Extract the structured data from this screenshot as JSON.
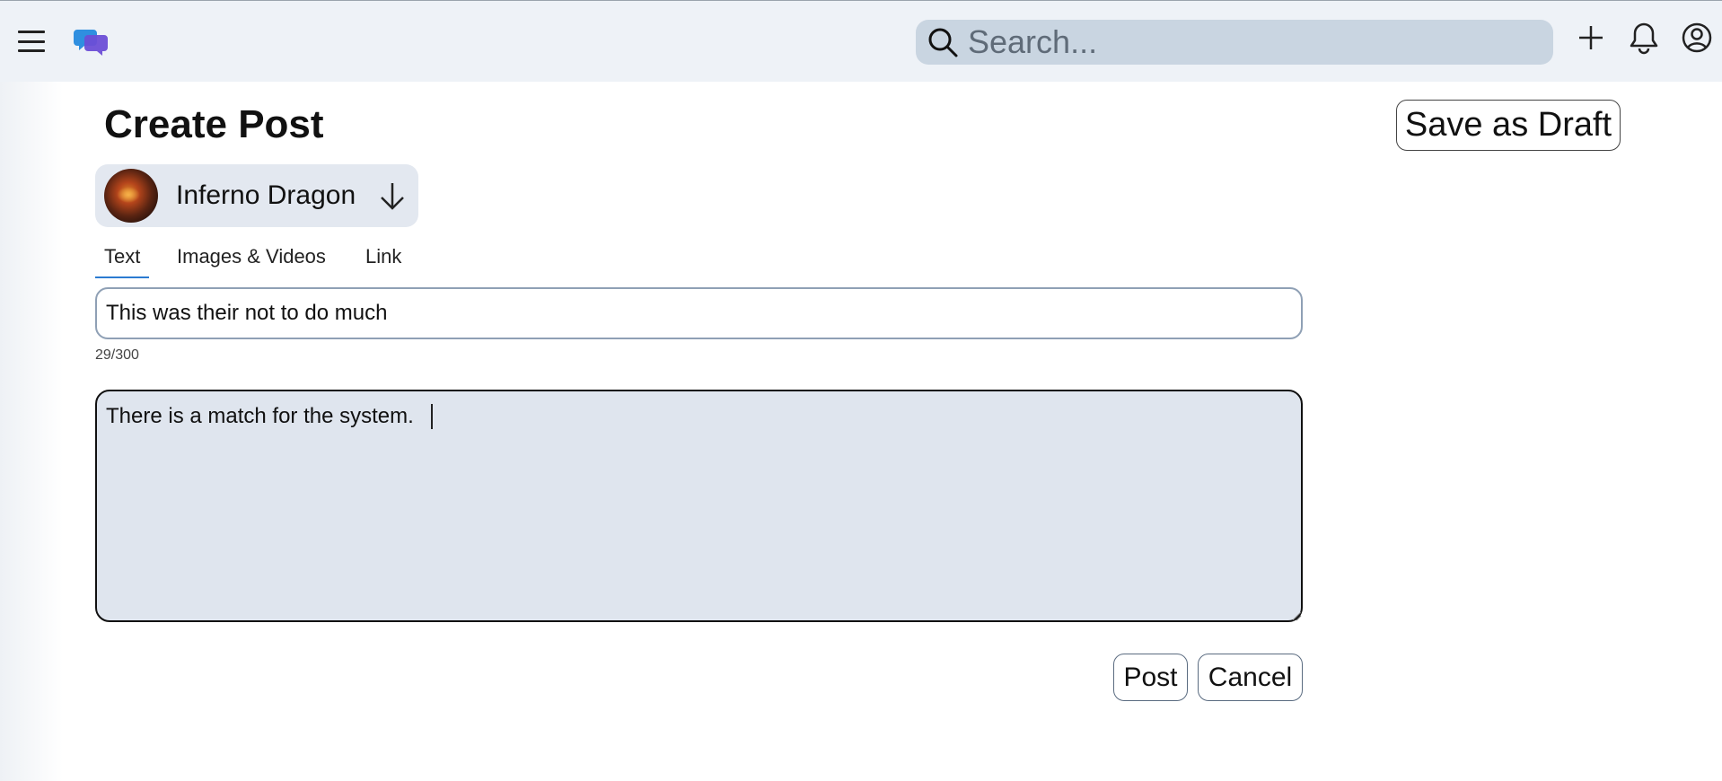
{
  "header": {
    "search_placeholder": "Search...",
    "icons": [
      "menu-icon",
      "app-logo-icon",
      "search-icon",
      "plus-icon",
      "bell-icon",
      "profile-icon"
    ]
  },
  "page": {
    "title": "Create Post",
    "save_draft_label": "Save as Draft"
  },
  "community": {
    "name": "Inferno Dragon",
    "dropdown_icon": "arrow-down-icon"
  },
  "tabs": [
    {
      "label": "Text",
      "active": true
    },
    {
      "label": "Images & Videos",
      "active": false
    },
    {
      "label": "Link",
      "active": false
    }
  ],
  "form": {
    "title_value": "This was their not to do much",
    "title_counter": "29/300",
    "body_value": "There is a match for the system. "
  },
  "actions": {
    "post_label": "Post",
    "cancel_label": "Cancel"
  },
  "colors": {
    "topbar_bg": "#eef2f7",
    "search_bg": "#c9d5e1",
    "community_chip_bg": "#e3e8f0",
    "body_input_bg": "#dfe5ee",
    "tab_underline": "#2b7bd1"
  }
}
